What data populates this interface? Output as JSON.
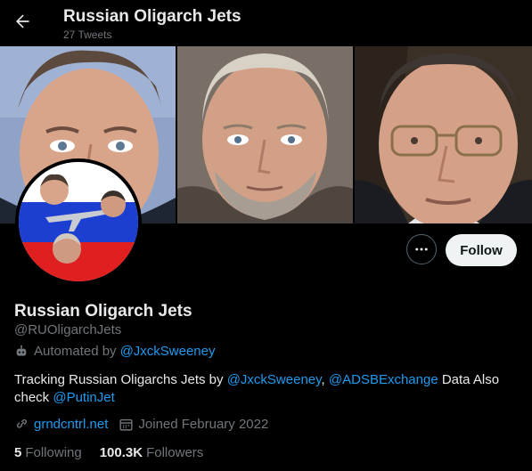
{
  "header": {
    "title": "Russian Oligarch Jets",
    "tweet_count": "27 Tweets"
  },
  "banner": {
    "panels": [
      "photo-left",
      "photo-middle",
      "photo-right"
    ]
  },
  "profile": {
    "name": "Russian Oligarch Jets",
    "handle": "@RUOligarchJets",
    "automated_prefix": "Automated by",
    "automated_by": "@JxckSweeney",
    "bio": {
      "text1": "Tracking Russian Oligarchs Jets by ",
      "link1": "@JxckSweeney",
      "sep": ", ",
      "link2": "@ADSBExchange",
      "text2": " Data Also check ",
      "link3": "@PutinJet"
    },
    "website": "grndcntrl.net",
    "joined": "Joined February 2022",
    "following_count": "5",
    "following_label": "Following",
    "followers_count": "100.3K",
    "followers_label": "Followers"
  },
  "actions": {
    "follow_label": "Follow",
    "more_icon": "more-icon"
  },
  "colors": {
    "background": "#000000",
    "accent": "#1d9bf0",
    "muted": "#71767b",
    "text": "#e7e9ea",
    "follow_bg": "#eff3f4"
  }
}
